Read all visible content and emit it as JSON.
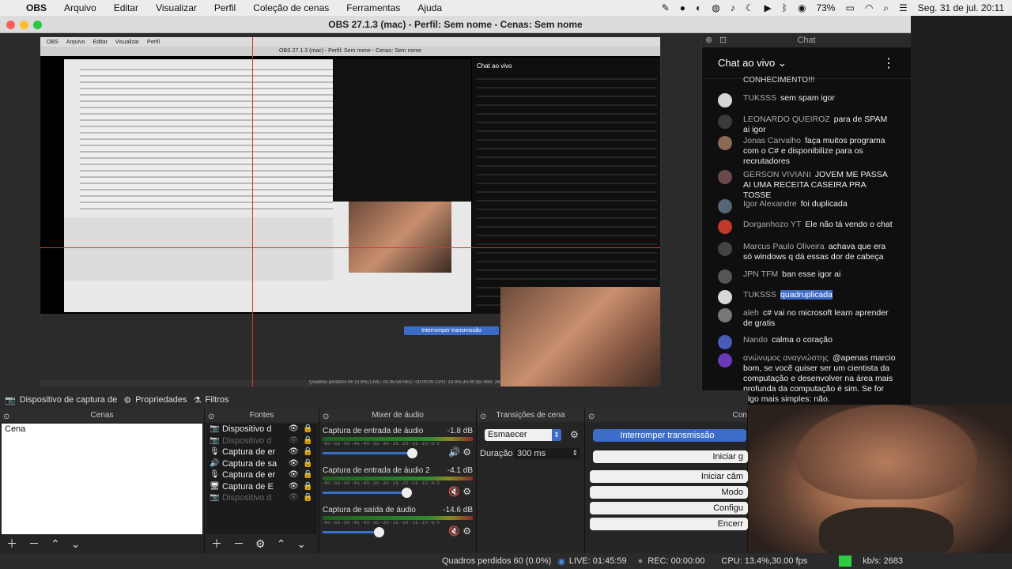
{
  "menubar": {
    "apple": "",
    "app": "OBS",
    "items": [
      "Arquivo",
      "Editar",
      "Visualizar",
      "Perfil",
      "Coleção de cenas",
      "Ferramentas",
      "Ajuda"
    ],
    "battery": "73%",
    "datetime": "Seg. 31 de jul.  20:11"
  },
  "window": {
    "title": "OBS 27.1.3 (mac) - Perfil: Sem nome - Cenas: Sem nome"
  },
  "nested": {
    "title": "OBS 27.1.3 (mac) - Perfil: Sem nome - Cenas: Sem nome",
    "chat_title": "Chat ao vivo",
    "chat_header": "Chat",
    "interrupt": "Interromper transmissão",
    "status": "Quadros perdidos 60 (0.0%)   LIVE: 01:45:59   REC: 00:00:00   CPU: 13.4%,30.00 fps   kb/s: 2683"
  },
  "chat": {
    "window_title": "Chat",
    "header": "Chat ao vivo",
    "top_fragment": "CONHECIMENTO!!!",
    "messages": [
      {
        "name": "TUKSSS",
        "text": "sem spam igor",
        "avatar": "#d8d8d8"
      },
      {
        "name": "LEONARDO QUEIROZ",
        "text": "para de SPAM ai igor",
        "avatar": "#3a3a3a"
      },
      {
        "name": "Jonas Carvalho",
        "text": "faça muitos programa com o C# e disponibilize para os recrutadores",
        "avatar": "#8a6a55"
      },
      {
        "name": "GERSON VIVIANI",
        "text": "JOVEM ME PASSA AI UMA RECEITA CASEIRA PRA TOSSE",
        "avatar": "#6a4a4a"
      },
      {
        "name": "Igor Alexandre",
        "text": "foi duplicada",
        "avatar": "#556677"
      },
      {
        "name": "Dorganhozo YT",
        "text": "Ele não tá vendo o chat",
        "avatar": "#c0392b"
      },
      {
        "name": "Marcus Paulo Oliveira",
        "text": "achava que era só windows q dá essas dor de cabeça",
        "avatar": "#444"
      },
      {
        "name": "JPN TFM",
        "text": "ban esse igor ai",
        "avatar": "#555"
      },
      {
        "name": "TUKSSS",
        "text": "quadruplicada",
        "avatar": "#d8d8d8"
      },
      {
        "name": "aleh",
        "text": "c# vai no microsoft learn aprender de gratis",
        "avatar": "#777"
      },
      {
        "name": "Nando",
        "text": "calma o coração",
        "avatar": "#4a5ab8"
      },
      {
        "name": "ανώνυμος αναγνώστης",
        "text": "@apenas marcio bom, se você quiser ser um cientista da computação e desenvolver na área mais profunda da computação é sim. Se for algo mais simples: não.",
        "avatar": "#6a3ab8"
      }
    ]
  },
  "sourcebar": {
    "source": "Dispositivo de captura de",
    "properties": "Propriedades",
    "filters": "Filtros"
  },
  "docks": {
    "scenes": {
      "title": "Cenas",
      "items": [
        "Cena"
      ]
    },
    "sources": {
      "title": "Fontes",
      "items": [
        {
          "label": "Dispositivo d",
          "icon": "camera-icon",
          "glyph": "📷",
          "dim": false
        },
        {
          "label": "Dispositivo d",
          "icon": "camera-icon",
          "glyph": "📷",
          "dim": true
        },
        {
          "label": "Captura de er",
          "icon": "microphone-icon",
          "glyph": "🎙",
          "dim": false
        },
        {
          "label": "Captura de sa",
          "icon": "speaker-icon",
          "glyph": "🔊",
          "dim": false
        },
        {
          "label": "Captura de er",
          "icon": "microphone-icon",
          "glyph": "🎙",
          "dim": false
        },
        {
          "label": "Captura de E",
          "icon": "monitor-icon",
          "glyph": "🖥",
          "dim": false
        },
        {
          "label": "Dispositivo d",
          "icon": "camera-icon",
          "glyph": "📷",
          "dim": true
        }
      ]
    },
    "mixer": {
      "title": "Mixer de áudio",
      "channels": [
        {
          "name": "Captura de entrada de áudio",
          "db": "-1.8 dB",
          "level": 0.88,
          "muted": false
        },
        {
          "name": "Captura de entrada de áudio 2",
          "db": "-4.1 dB",
          "level": 0.82,
          "muted": true
        },
        {
          "name": "Captura de saída de áudio",
          "db": "-14.6 dB",
          "level": 0.55,
          "muted": true
        }
      ],
      "scale": "-60 -55 -50 -45 -40 -35 -30 -25 -20 -15 -10 -5 0"
    },
    "transitions": {
      "title": "Transições de cena",
      "selected": "Esmaecer",
      "duration_label": "Duração",
      "duration": "300 ms"
    },
    "controls": {
      "title": "Con",
      "buttons": [
        "Interromper transmissão",
        "Iniciar g",
        "Iniciar câm",
        "Modo",
        "Configu",
        "Encerr"
      ]
    }
  },
  "status": {
    "dropped": "Quadros perdidos 60 (0.0%)",
    "live": "LIVE: 01:45:59",
    "rec": "REC: 00:00:00",
    "cpu": "CPU: 13.4%,30.00 fps",
    "kbps": "kb/s: 2683"
  },
  "colors": {
    "accent": "#3b6cc7",
    "live": "#4a90e2",
    "good": "#2ecc40"
  }
}
